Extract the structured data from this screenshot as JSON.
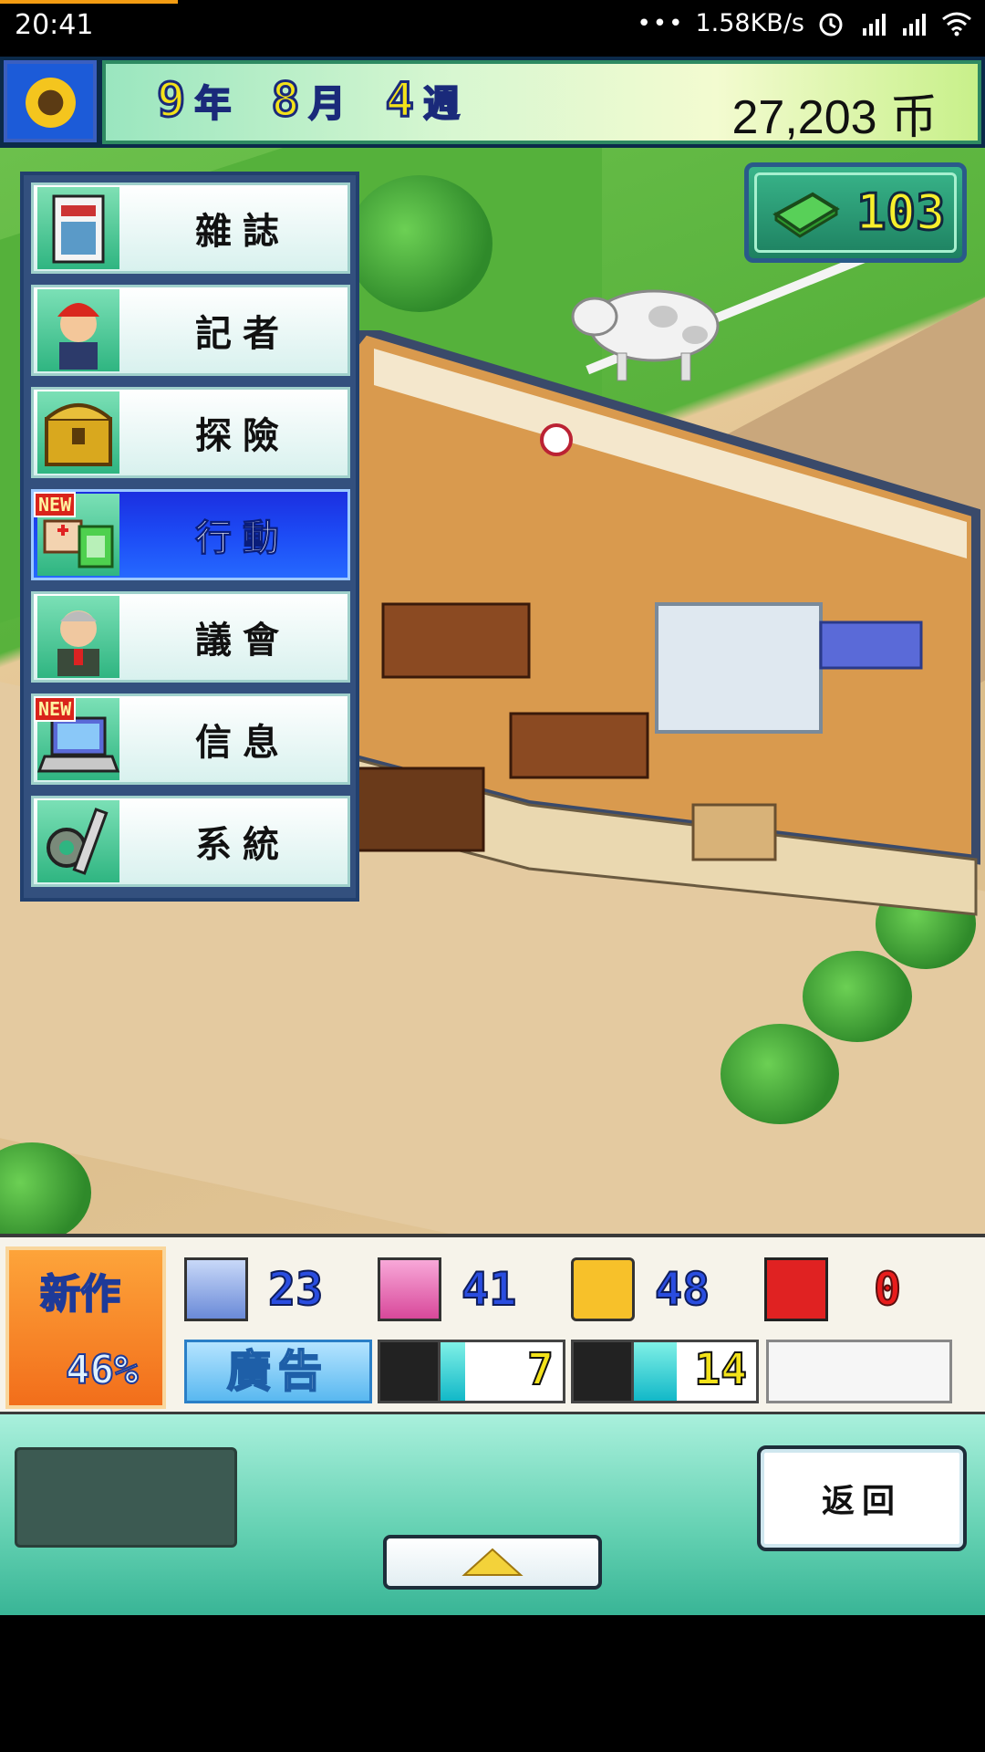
{
  "status_bar": {
    "time": "20:41",
    "signal_dots": "•••",
    "network_speed": "1.58KB/s"
  },
  "top_bar": {
    "year_value": "9",
    "year_unit": "年",
    "month_value": "8",
    "month_unit": "月",
    "week_value": "4",
    "week_unit": "週",
    "money": "27,203",
    "money_unit": "币"
  },
  "cash_badge": {
    "value": "103"
  },
  "menu": {
    "items": [
      {
        "label": "雜誌",
        "icon": "magazine-icon",
        "new": false,
        "active": false
      },
      {
        "label": "記者",
        "icon": "reporter-icon",
        "new": false,
        "active": false
      },
      {
        "label": "探險",
        "icon": "treasure-chest-icon",
        "new": false,
        "active": false
      },
      {
        "label": "行動",
        "icon": "action-icon",
        "new": true,
        "active": true
      },
      {
        "label": "議會",
        "icon": "council-icon",
        "new": false,
        "active": false
      },
      {
        "label": "信息",
        "icon": "laptop-icon",
        "new": true,
        "active": false
      },
      {
        "label": "系統",
        "icon": "gear-wrench-icon",
        "new": false,
        "active": false
      }
    ],
    "new_tag": "NEW"
  },
  "stats": {
    "new_work_label": "新作",
    "new_work_percent": "46%",
    "stat1": "23",
    "stat2": "41",
    "stat3": "48",
    "stat4": "0",
    "ad_label": "廣告",
    "gauge1_value": "7",
    "gauge1_fill": 0.2,
    "gauge2_value": "14",
    "gauge2_fill": 0.35
  },
  "controls": {
    "back_label": "返回"
  },
  "colors": {
    "active_menu": "#1d4bf5",
    "money_text": "#f7ef2c",
    "stat_blue": "#2a4de0",
    "stat_red": "#e81c1c"
  }
}
